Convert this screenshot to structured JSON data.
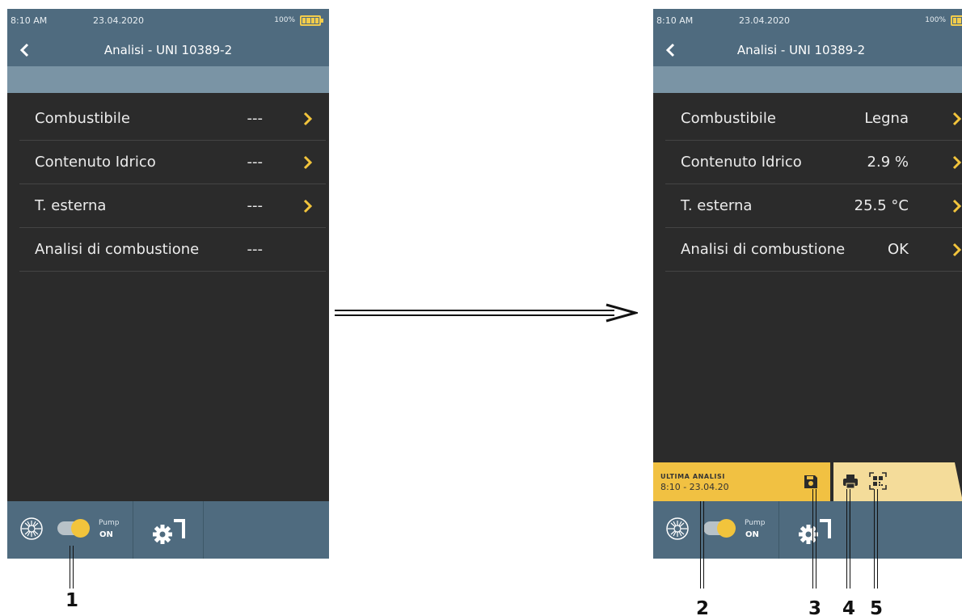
{
  "status": {
    "time": "8:10 AM",
    "date": "23.04.2020",
    "battery": "100%"
  },
  "title": "Analisi - UNI 10389-2",
  "left_screen": {
    "rows": [
      {
        "label": "Combustibile",
        "value": "---",
        "has_chevron": true
      },
      {
        "label": "Contenuto Idrico",
        "value": "---",
        "has_chevron": true
      },
      {
        "label": "T. esterna",
        "value": "---",
        "has_chevron": true
      },
      {
        "label": "Analisi di combustione",
        "value": "---",
        "has_chevron": false
      }
    ]
  },
  "right_screen": {
    "rows": [
      {
        "label": "Combustibile",
        "value": "Legna",
        "has_chevron": true
      },
      {
        "label": "Contenuto Idrico",
        "value": "2.9 %",
        "has_chevron": true
      },
      {
        "label": "T. esterna",
        "value": "25.5 °C",
        "has_chevron": true
      },
      {
        "label": "Analisi di combustione",
        "value": "OK",
        "has_chevron": true
      }
    ],
    "last_analysis": {
      "heading": "ULTIMA ANALISI",
      "timestamp": "8:10 - 23.04.20"
    }
  },
  "bottom_bar": {
    "pump_label": "Pump",
    "pump_state": "ON"
  },
  "callouts": [
    "1",
    "2",
    "3",
    "4",
    "5"
  ],
  "colors": {
    "bar": "#4f6b7f",
    "subbar": "#7a94a5",
    "body": "#2b2b2b",
    "accent": "#f2c43c",
    "action_bar": "#f4dc9a"
  }
}
